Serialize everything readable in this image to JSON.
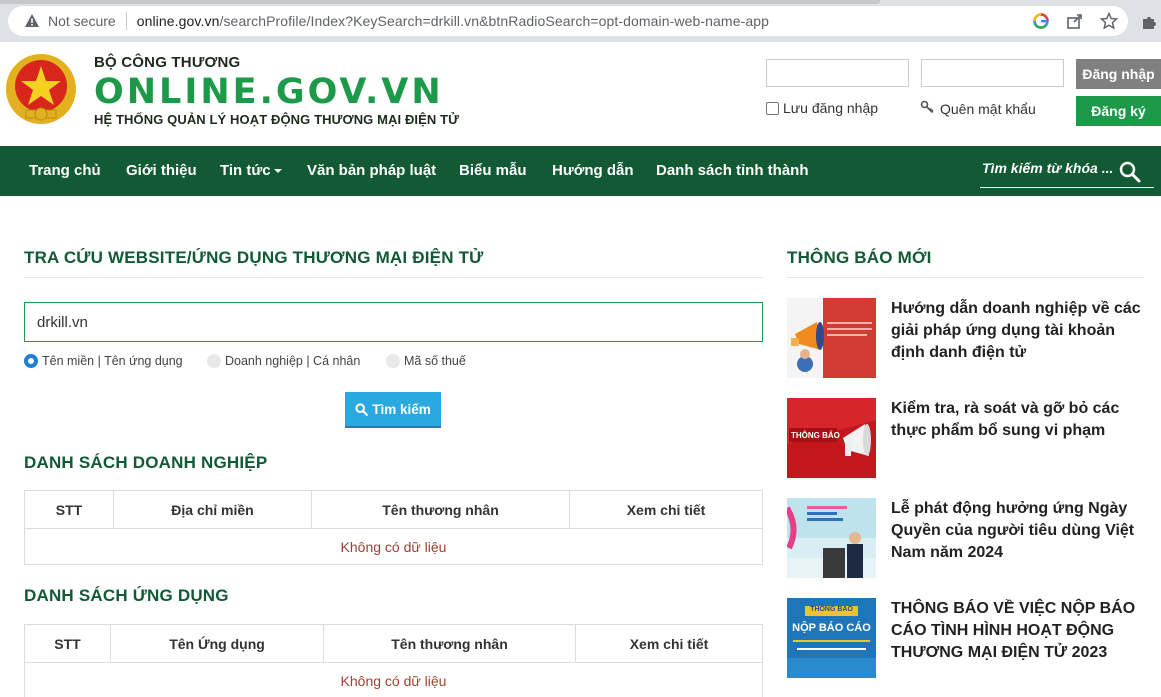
{
  "browser": {
    "security_label": "Not secure",
    "url_host": "online.gov.vn",
    "url_path": "/searchProfile/Index?KeySearch=drkill.vn&btnRadioSearch=opt-domain-web-name-app"
  },
  "header": {
    "org_top": "BỘ CÔNG THƯƠNG",
    "site_name": "ONLINE.GOV.VN",
    "subtitle": "HỆ THỐNG QUẢN LÝ HOẠT ĐỘNG THƯƠNG MẠI ĐIỆN TỬ",
    "login_label": "Đăng nhập",
    "remember_label": "Lưu đăng nhập",
    "forgot_label": "Quên mật khẩu",
    "register_label": "Đăng ký"
  },
  "nav": {
    "items": [
      "Trang chủ",
      "Giới thiệu",
      "Tin tức",
      "Văn bản pháp luật",
      "Biểu mẫu",
      "Hướng dẫn",
      "Danh sách tỉnh thành"
    ],
    "search_placeholder": "Tìm kiếm từ khóa ..."
  },
  "main": {
    "lookup_title": "TRA CỨU WEBSITE/ỨNG DỤNG THƯƠNG MẠI ĐIỆN TỬ",
    "search_value": "drkill.vn",
    "radios": [
      {
        "label": "Tên miền | Tên ứng dụng",
        "selected": true
      },
      {
        "label": "Doanh nghiệp | Cá nhân",
        "selected": false
      },
      {
        "label": "Mã số thuế",
        "selected": false
      }
    ],
    "search_button": "Tìm kiếm",
    "business_title": "DANH SÁCH DOANH NGHIỆP",
    "business_headers": [
      "STT",
      "Địa chỉ miền",
      "Tên thương nhân",
      "Xem chi tiết"
    ],
    "business_empty": "Không có dữ liệu",
    "apps_title": "DANH SÁCH ỨNG DỤNG",
    "apps_headers": [
      "STT",
      "Tên Ứng dụng",
      "Tên thương nhân",
      "Xem chi tiết"
    ],
    "apps_empty": "Không có dữ liệu"
  },
  "sidebar": {
    "title": "THÔNG BÁO MỚI",
    "news": [
      {
        "title": "Hướng dẫn doanh nghiệp về các giải pháp ứng dụng tài khoản định danh điện tử"
      },
      {
        "title": "Kiểm tra, rà soát và gỡ bỏ các thực phẩm bổ sung vi phạm",
        "thumb_text": "THÔNG BÁO"
      },
      {
        "title": "Lễ phát động hưởng ứng Ngày Quyền của người tiêu dùng Việt Nam năm 2024"
      },
      {
        "title": "THÔNG BÁO VỀ VIỆC NỘP BÁO CÁO TÌNH HÌNH HOẠT ĐỘNG THƯƠNG MẠI ĐIỆN TỬ 2023",
        "thumb_top": "THÔNG BÁO",
        "thumb_main": "NỘP BÁO CÁO"
      }
    ]
  },
  "colors": {
    "brand_green": "#1c9a4a",
    "nav_green": "#115a33",
    "search_blue": "#29a9df",
    "empty_text": "#a14030"
  }
}
